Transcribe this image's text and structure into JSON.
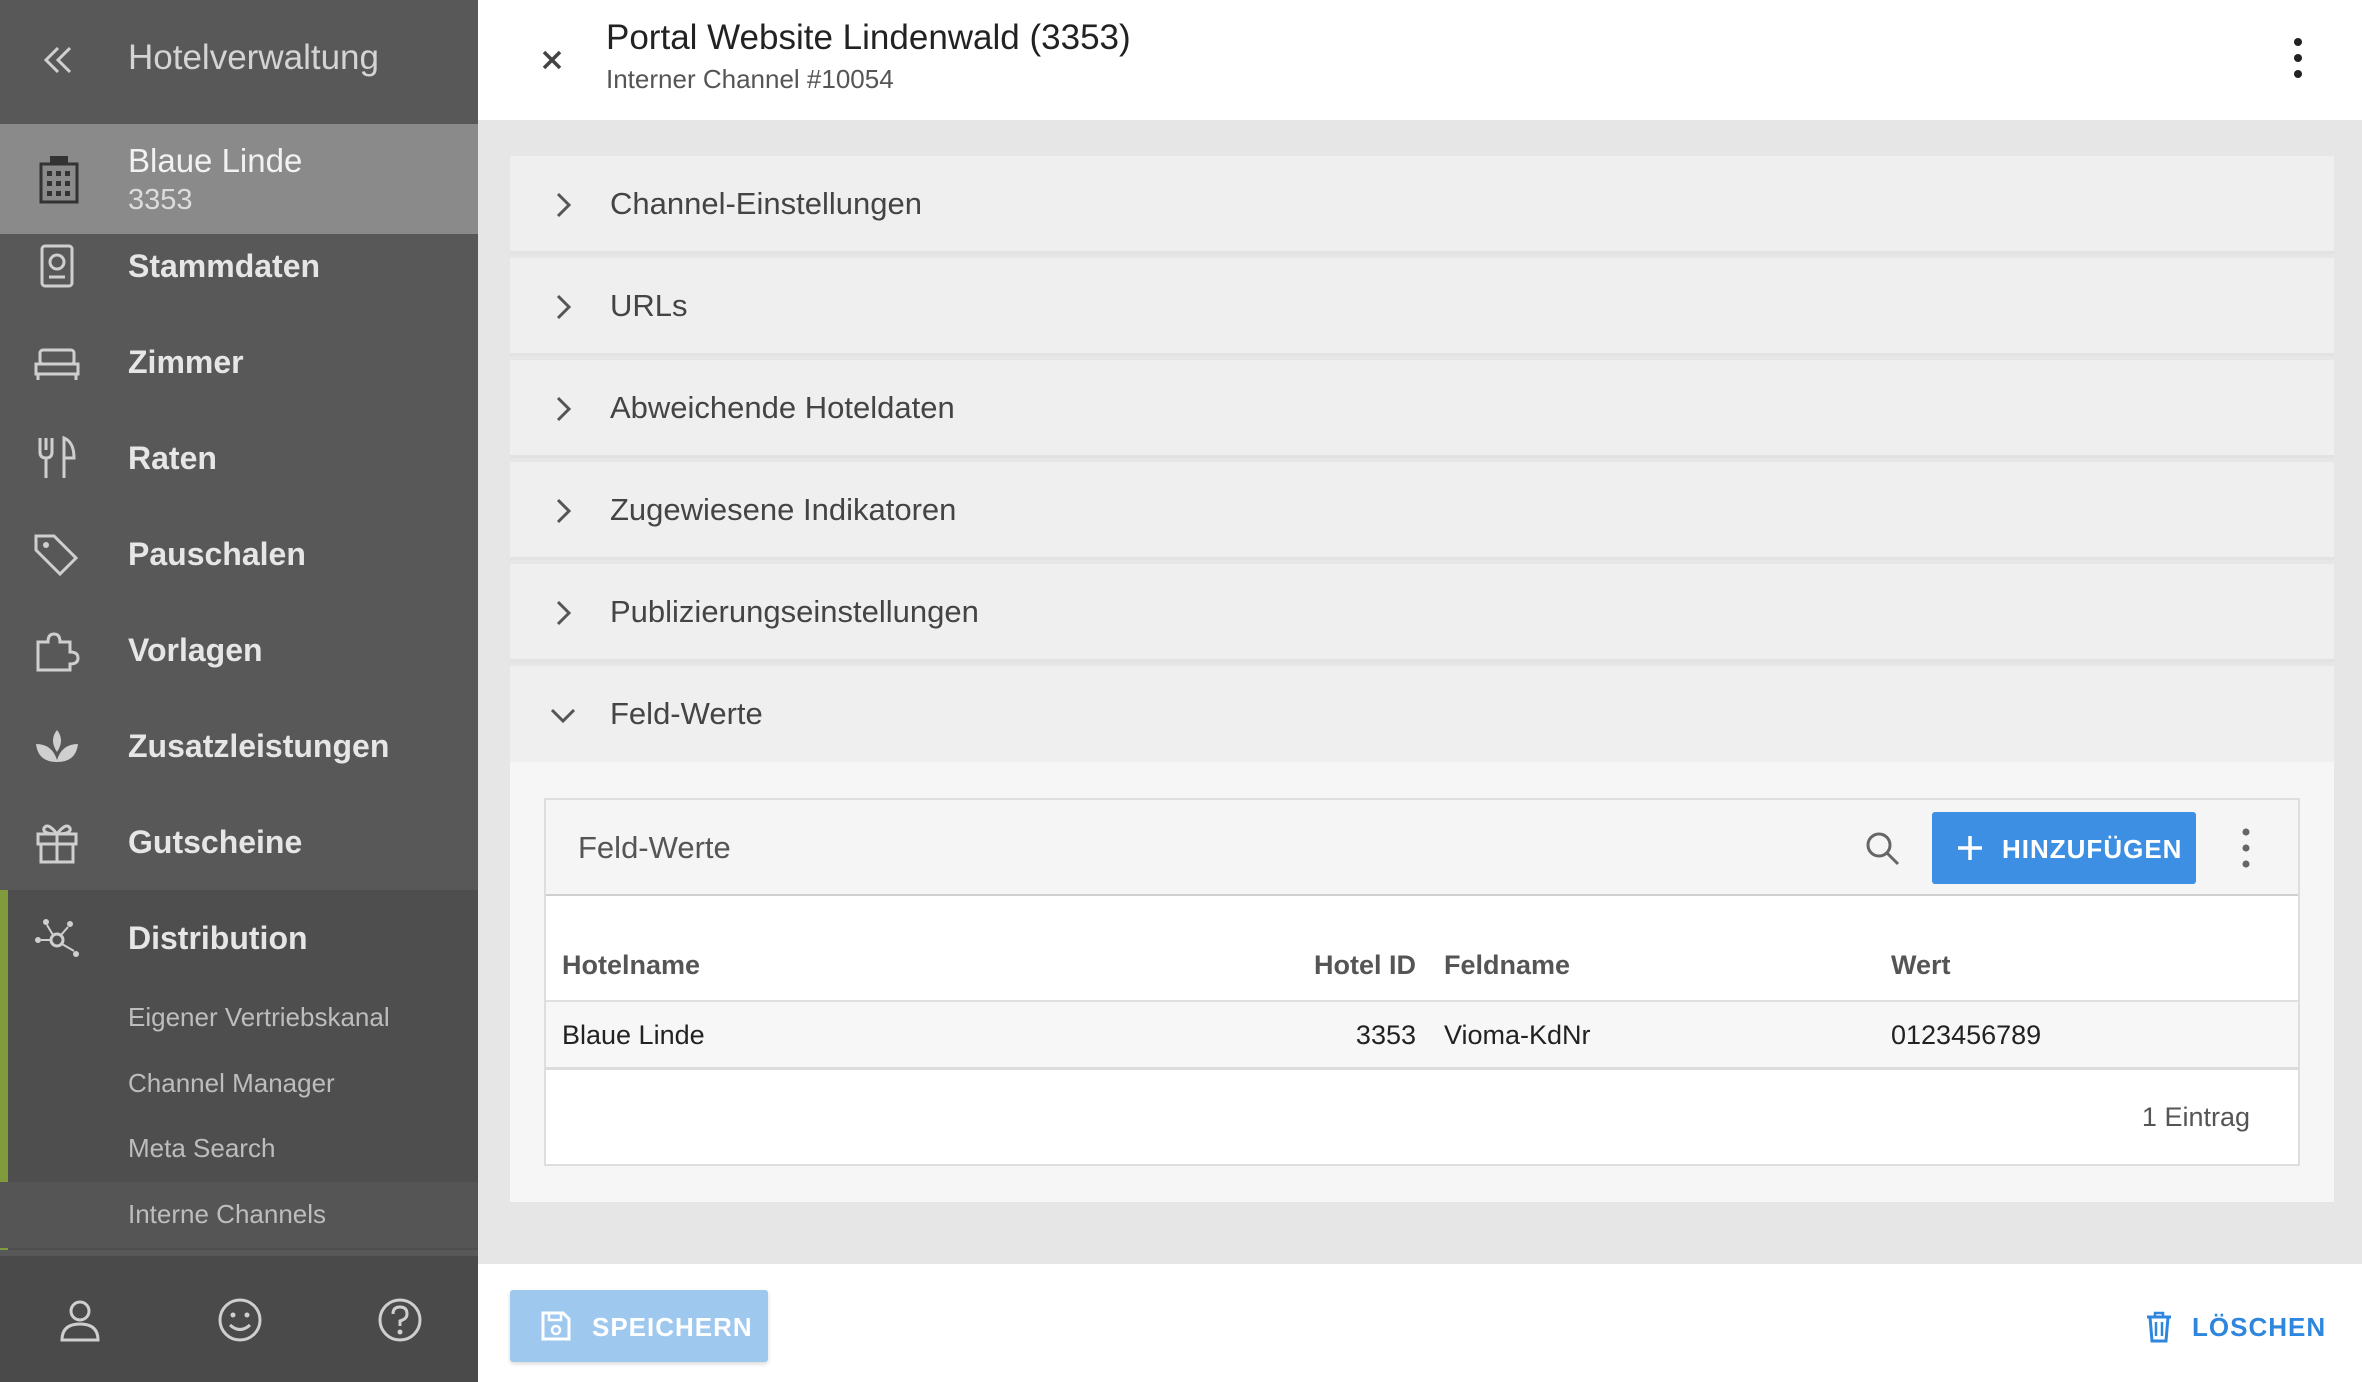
{
  "sidebar": {
    "title": "Hotelverwaltung",
    "hotel": {
      "name": "Blaue Linde",
      "id": "3353"
    },
    "items": [
      {
        "label": "Stammdaten",
        "icon": "passport-icon"
      },
      {
        "label": "Zimmer",
        "icon": "bed-icon"
      },
      {
        "label": "Raten",
        "icon": "cutlery-icon"
      },
      {
        "label": "Pauschalen",
        "icon": "tags-icon"
      },
      {
        "label": "Vorlagen",
        "icon": "puzzle-icon"
      },
      {
        "label": "Zusatzleistungen",
        "icon": "spa-icon"
      },
      {
        "label": "Gutscheine",
        "icon": "gift-icon"
      },
      {
        "label": "Distribution",
        "icon": "network-icon"
      }
    ],
    "sub_items": [
      {
        "label": "Eigener Vertriebskanal"
      },
      {
        "label": "Channel Manager"
      },
      {
        "label": "Meta Search"
      },
      {
        "label": "Interne Channels"
      }
    ],
    "active_sub_item": "Interne Channels",
    "accent_color": "#7f9b3c"
  },
  "header": {
    "title": "Portal Website Lindenwald (3353)",
    "subtitle": "Interner Channel #10054"
  },
  "panels": [
    {
      "title": "Channel-Einstellungen",
      "expanded": false
    },
    {
      "title": "URLs",
      "expanded": false
    },
    {
      "title": "Abweichende Hoteldaten",
      "expanded": false
    },
    {
      "title": "Zugewiesene Indikatoren",
      "expanded": false
    },
    {
      "title": "Publizierungseinstellungen",
      "expanded": false
    },
    {
      "title": "Feld-Werte",
      "expanded": true
    }
  ],
  "field_values": {
    "card_title": "Feld-Werte",
    "add_label": "HINZUFÜGEN",
    "columns": [
      "Hotelname",
      "Hotel ID",
      "Feldname",
      "Wert"
    ],
    "rows": [
      [
        "Blaue Linde",
        "3353",
        "Vioma-KdNr",
        "0123456789"
      ]
    ],
    "footer": "1 Eintrag"
  },
  "actions": {
    "save_label": "SPEICHERN",
    "delete_label": "LÖSCHEN",
    "primary_color": "#3d8fe3"
  }
}
